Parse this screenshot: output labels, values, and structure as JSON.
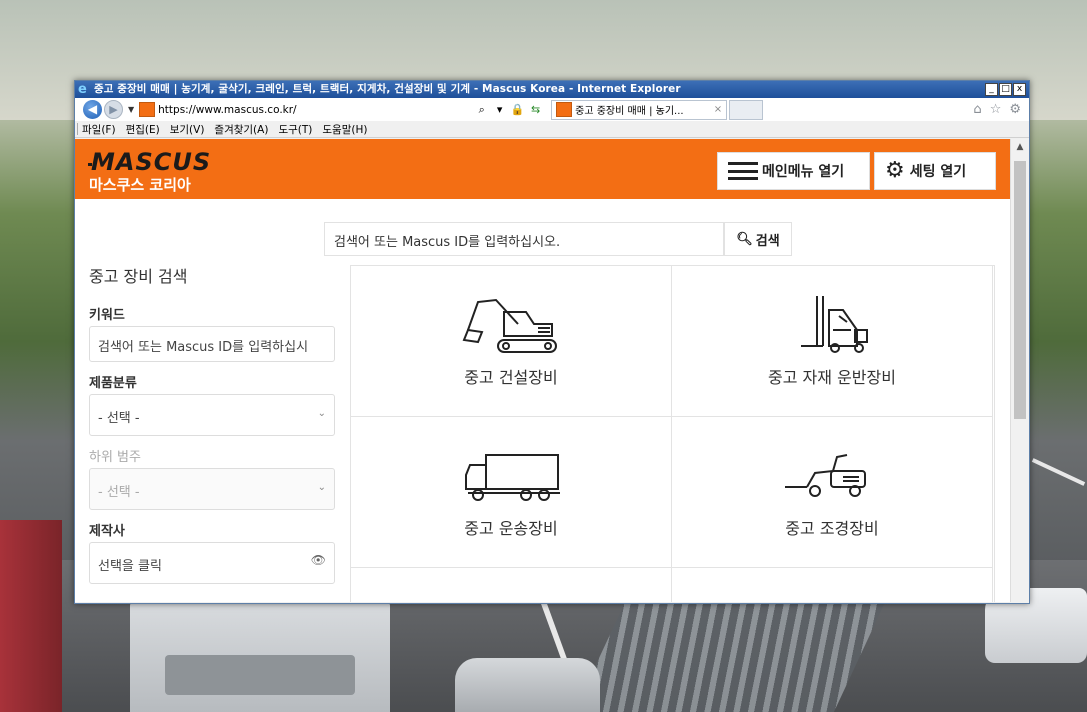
{
  "browser": {
    "window_title": "중고 중장비 매매 | 농기계, 굴삭기, 크레인, 트럭, 트랙터, 지게차, 건설장비 및 기계 - Mascus Korea - Internet Explorer",
    "url_prefix": "https://",
    "url_domain": "www.mascus.co.kr/",
    "tab_title": "중고 중장비 매매 | 농기...",
    "tab_close": "×",
    "menu": [
      "파일(F)",
      "편집(E)",
      "보기(V)",
      "즐겨찾기(A)",
      "도구(T)",
      "도움말(H)"
    ],
    "window_buttons": [
      "_",
      "□",
      "x"
    ]
  },
  "header": {
    "logo_text": "MASCUS",
    "logo_sub": "마스쿠스 코리아",
    "menu_button": "메인메뉴 열기",
    "settings_button": "세팅 열기",
    "accent_color": "#f36e14"
  },
  "search": {
    "placeholder": "검색어 또는 Mascus ID를 입력하십시오.",
    "button": "검색"
  },
  "sidebar": {
    "title": "중고 장비 검색",
    "keyword_label": "키워드",
    "keyword_placeholder": "검색어 또는 Mascus ID를 입력하십시",
    "category_label": "제품분류",
    "category_value": "- 선택 -",
    "subcategory_label": "하위 범주",
    "subcategory_value": "- 선택 -",
    "maker_label": "제작사",
    "maker_value": "선택을 클릭"
  },
  "categories": [
    {
      "label": "중고 건설장비",
      "icon": "excavator-icon"
    },
    {
      "label": "중고 자재 운반장비",
      "icon": "forklift-icon"
    },
    {
      "label": "중고 운송장비",
      "icon": "truck-icon"
    },
    {
      "label": "중고 조경장비",
      "icon": "lawn-mower-icon"
    }
  ]
}
